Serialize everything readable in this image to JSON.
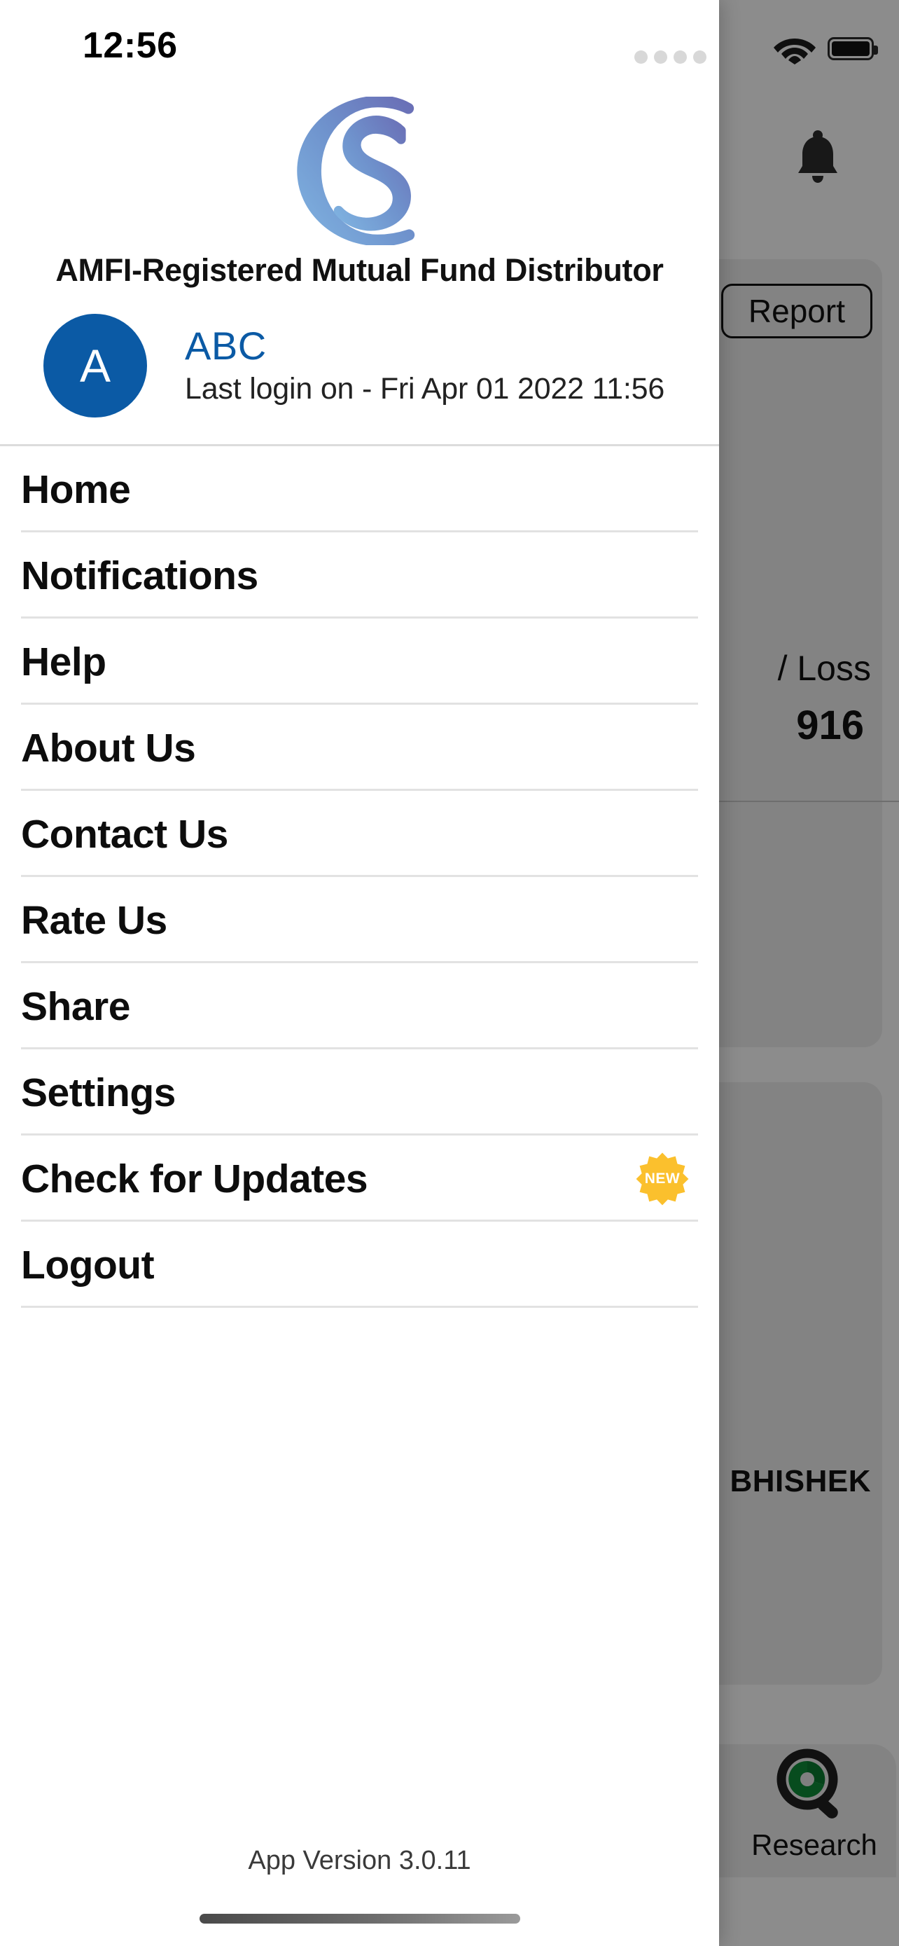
{
  "status_bar": {
    "time": "12:56",
    "signal_dots": 4,
    "wifi_icon": "wifi-icon",
    "battery_icon": "battery-full-icon"
  },
  "drawer": {
    "brand": {
      "logo_icon": "cs-monogram-logo",
      "logo_colors": {
        "light": "#7fa9dc",
        "dark": "#6b71b8"
      },
      "tagline": "AMFI-Registered Mutual Fund Distributor"
    },
    "profile": {
      "avatar_initial": "A",
      "avatar_color": "#0b5aa5",
      "name": "ABC",
      "name_color": "#0b5aa5",
      "last_login": "Last login on - Fri Apr 01 2022 11:56"
    },
    "menu": [
      {
        "label": "Home",
        "badge": null
      },
      {
        "label": "Notifications",
        "badge": null
      },
      {
        "label": "Help",
        "badge": null
      },
      {
        "label": "About Us",
        "badge": null
      },
      {
        "label": "Contact Us",
        "badge": null
      },
      {
        "label": "Rate Us",
        "badge": null
      },
      {
        "label": "Share",
        "badge": null
      },
      {
        "label": "Settings",
        "badge": null
      },
      {
        "label": "Check for Updates",
        "badge": "NEW"
      },
      {
        "label": "Logout",
        "badge": null
      }
    ],
    "badge_color": "#fbc02d",
    "footer": {
      "app_version": "App Version 3.0.11"
    }
  },
  "background_screen": {
    "notification_icon": "bell-icon",
    "report_button": "Report",
    "profit_loss_label": "/ Loss",
    "profit_loss_value": "916",
    "investor_name": "BHISHEK",
    "tab_bar": [
      {
        "label": "Research",
        "icon": "research-magnifier-pie-icon"
      }
    ]
  }
}
